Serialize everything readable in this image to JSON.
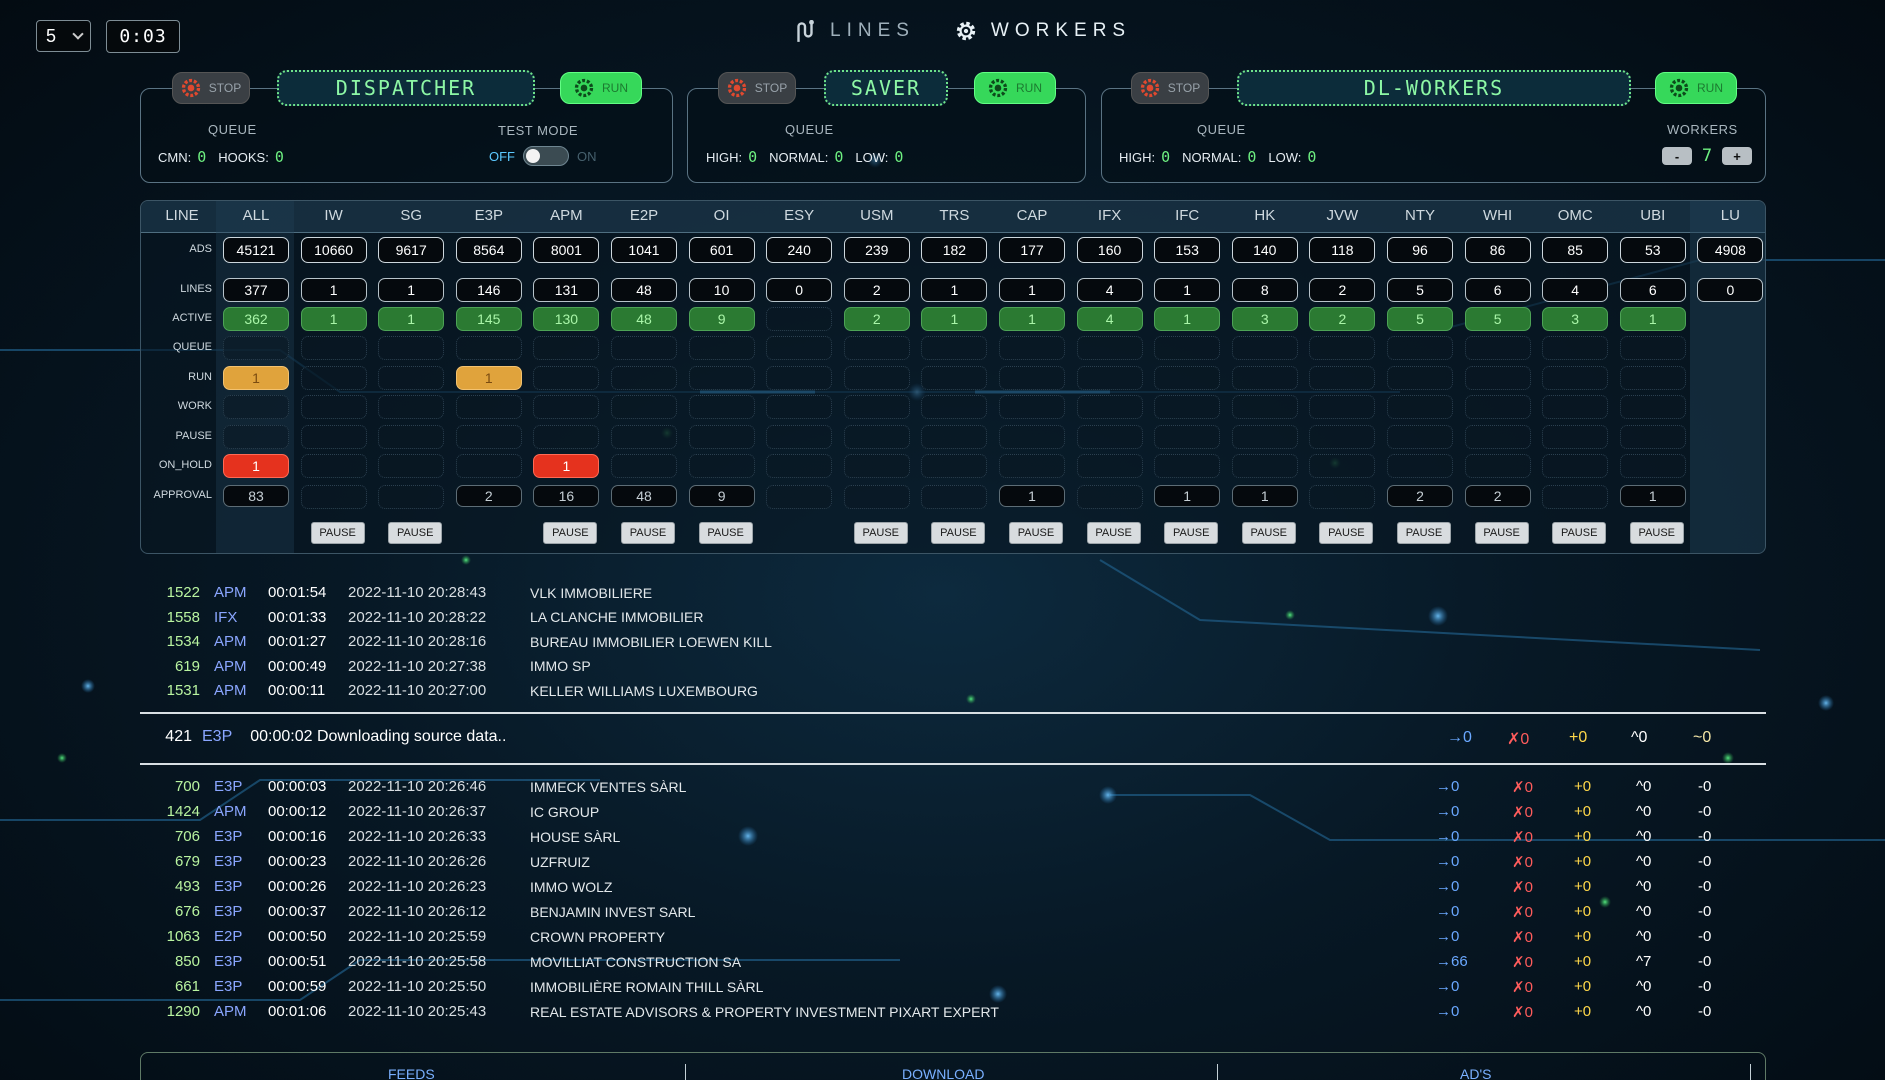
{
  "top": {
    "refresh_select": "5",
    "timer": "0:03",
    "nav": [
      {
        "label": "LINES",
        "icon": "lines-icon",
        "active": false
      },
      {
        "label": "WORKERS",
        "icon": "gear-icon",
        "active": true
      }
    ]
  },
  "panels": {
    "dispatcher": {
      "title": "DISPATCHER",
      "stop_label": "STOP",
      "run_label": "RUN",
      "queue_label": "QUEUE",
      "cmn_label": "CMN:",
      "cmn": "0",
      "hooks_label": "HOOKS:",
      "hooks": "0",
      "test_mode_label": "TEST MODE",
      "off_label": "OFF",
      "on_label": "ON",
      "test_mode": false
    },
    "saver": {
      "title": "SAVER",
      "stop_label": "STOP",
      "run_label": "RUN",
      "queue_label": "QUEUE",
      "high_label": "HIGH:",
      "high": "0",
      "normal_label": "NORMAL:",
      "normal": "0",
      "low_label": "LOW:",
      "low": "0"
    },
    "dl_workers": {
      "title": "DL-WORKERS",
      "stop_label": "STOP",
      "run_label": "RUN",
      "queue_label": "QUEUE",
      "high_label": "HIGH:",
      "high": "0",
      "normal_label": "NORMAL:",
      "normal": "0",
      "low_label": "LOW:",
      "low": "0",
      "workers_label": "WORKERS",
      "workers": "7",
      "minus_label": "-",
      "plus_label": "+"
    }
  },
  "grid": {
    "line_header": "LINE",
    "row_labels": [
      "ADS",
      "LINES",
      "ACTIVE",
      "QUEUE",
      "RUN",
      "WORK",
      "PAUSE",
      "ON_HOLD",
      "APPROVAL"
    ],
    "columns": [
      "ALL",
      "IW",
      "SG",
      "E3P",
      "APM",
      "E2P",
      "OI",
      "ESY",
      "USM",
      "TRS",
      "CAP",
      "IFX",
      "IFC",
      "HK",
      "JVW",
      "NTY",
      "WHI",
      "OMC",
      "UBI",
      "LU"
    ],
    "ads": [
      "45121",
      "10660",
      "9617",
      "8564",
      "8001",
      "1041",
      "601",
      "240",
      "239",
      "182",
      "177",
      "160",
      "153",
      "140",
      "118",
      "96",
      "86",
      "85",
      "53",
      "4908"
    ],
    "lines": [
      "377",
      "1",
      "1",
      "146",
      "131",
      "48",
      "10",
      "0",
      "2",
      "1",
      "1",
      "4",
      "1",
      "8",
      "2",
      "5",
      "6",
      "4",
      "6",
      "0"
    ],
    "active": [
      "362",
      "1",
      "1",
      "145",
      "130",
      "48",
      "9",
      "",
      "2",
      "1",
      "1",
      "4",
      "1",
      "3",
      "2",
      "5",
      "5",
      "3",
      "1",
      ""
    ],
    "run": [
      "1",
      "",
      "",
      "1",
      "",
      "",
      "",
      "",
      "",
      "",
      "",
      "",
      "",
      "",
      "",
      "",
      "",
      "",
      "",
      ""
    ],
    "on_hold": [
      "1",
      "",
      "",
      "",
      "1",
      "",
      "",
      "",
      "",
      "",
      "",
      "",
      "",
      "",
      "",
      "",
      "",
      "",
      "",
      ""
    ],
    "approval": [
      "83",
      "",
      "",
      "2",
      "16",
      "48",
      "9",
      "",
      "",
      "",
      "1",
      "",
      "1",
      "1",
      "",
      "2",
      "2",
      "",
      "1",
      ""
    ],
    "pause_label": "PAUSE",
    "pause_columns": [
      "IW",
      "SG",
      "APM",
      "E2P",
      "OI",
      "USM",
      "TRS",
      "CAP",
      "IFX",
      "IFC",
      "HK",
      "JVW",
      "NTY",
      "WHI",
      "OMC",
      "UBI"
    ]
  },
  "recent_log": [
    {
      "id": "1522",
      "line": "APM",
      "dur": "00:01:54",
      "ts": "2022-11-10 20:28:43",
      "name": "VLK IMMOBILIERE"
    },
    {
      "id": "1558",
      "line": "IFX",
      "dur": "00:01:33",
      "ts": "2022-11-10 20:28:22",
      "name": "LA CLANCHE IMMOBILIER"
    },
    {
      "id": "1534",
      "line": "APM",
      "dur": "00:01:27",
      "ts": "2022-11-10 20:28:16",
      "name": "BUREAU IMMOBILIER LOEWEN KILL"
    },
    {
      "id": "619",
      "line": "APM",
      "dur": "00:00:49",
      "ts": "2022-11-10 20:27:38",
      "name": "IMMO SP"
    },
    {
      "id": "1531",
      "line": "APM",
      "dur": "00:00:11",
      "ts": "2022-11-10 20:27:00",
      "name": "KELLER WILLIAMS LUXEMBOURG"
    }
  ],
  "current": {
    "id": "421",
    "line": "E3P",
    "text": "00:00:02 Downloading source data..",
    "arrow": "→0",
    "x": "✗0",
    "plus": "+0",
    "up": "^0",
    "tilde": "~0"
  },
  "history_log": [
    {
      "id": "700",
      "line": "E3P",
      "dur": "00:00:03",
      "ts": "2022-11-10 20:26:46",
      "name": "IMMECK VENTES SÀRL",
      "arrow": "→0",
      "x": "✗0",
      "plus": "+0",
      "up": "^0",
      "minus": "-0"
    },
    {
      "id": "1424",
      "line": "APM",
      "dur": "00:00:12",
      "ts": "2022-11-10 20:26:37",
      "name": "IC GROUP",
      "arrow": "→0",
      "x": "✗0",
      "plus": "+0",
      "up": "^0",
      "minus": "-0"
    },
    {
      "id": "706",
      "line": "E3P",
      "dur": "00:00:16",
      "ts": "2022-11-10 20:26:33",
      "name": "HOUSE SÀRL",
      "arrow": "→0",
      "x": "✗0",
      "plus": "+0",
      "up": "^0",
      "minus": "-0"
    },
    {
      "id": "679",
      "line": "E3P",
      "dur": "00:00:23",
      "ts": "2022-11-10 20:26:26",
      "name": "UZFRUIZ",
      "arrow": "→0",
      "x": "✗0",
      "plus": "+0",
      "up": "^0",
      "minus": "-0"
    },
    {
      "id": "493",
      "line": "E3P",
      "dur": "00:00:26",
      "ts": "2022-11-10 20:26:23",
      "name": "IMMO WOLZ",
      "arrow": "→0",
      "x": "✗0",
      "plus": "+0",
      "up": "^0",
      "minus": "-0"
    },
    {
      "id": "676",
      "line": "E3P",
      "dur": "00:00:37",
      "ts": "2022-11-10 20:26:12",
      "name": "BENJAMIN INVEST SARL",
      "arrow": "→0",
      "x": "✗0",
      "plus": "+0",
      "up": "^0",
      "minus": "-0"
    },
    {
      "id": "1063",
      "line": "E2P",
      "dur": "00:00:50",
      "ts": "2022-11-10 20:25:59",
      "name": "CROWN PROPERTY",
      "arrow": "→0",
      "x": "✗0",
      "plus": "+0",
      "up": "^0",
      "minus": "-0"
    },
    {
      "id": "850",
      "line": "E3P",
      "dur": "00:00:51",
      "ts": "2022-11-10 20:25:58",
      "name": "MOVILLIAT CONSTRUCTION SA",
      "arrow": "→66",
      "x": "✗0",
      "plus": "+0",
      "up": "^7",
      "minus": "-0"
    },
    {
      "id": "661",
      "line": "E3P",
      "dur": "00:00:59",
      "ts": "2022-11-10 20:25:50",
      "name": "IMMOBILIÈRE ROMAIN THILL SÀRL",
      "arrow": "→0",
      "x": "✗0",
      "plus": "+0",
      "up": "^0",
      "minus": "-0"
    },
    {
      "id": "1290",
      "line": "APM",
      "dur": "00:01:06",
      "ts": "2022-11-10 20:25:43",
      "name": "REAL ESTATE ADVISORS & PROPERTY INVESTMENT PIXART EXPERT",
      "arrow": "→0",
      "x": "✗0",
      "plus": "+0",
      "up": "^0",
      "minus": "-0"
    }
  ],
  "bottom_tabs": [
    "FEEDS",
    "DOWNLOAD",
    "AD'S"
  ]
}
